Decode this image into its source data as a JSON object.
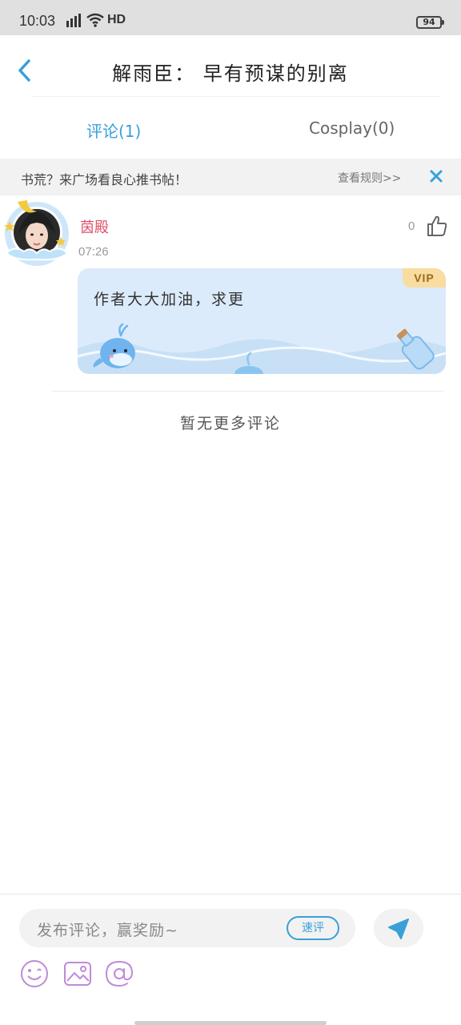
{
  "status_bar": {
    "time": "10:03",
    "network": "4G",
    "hd": "HD",
    "battery": "94"
  },
  "header": {
    "title": "解雨臣： 早有预谋的别离",
    "back_icon": "chevron-left-icon"
  },
  "tabs": [
    {
      "label": "评论(1)",
      "active": true
    },
    {
      "label": "Cosplay(0)",
      "active": false
    }
  ],
  "notice": {
    "text": "书荒？来广场看良心推书帖！",
    "rules_link": "查看规则>>",
    "close_icon": "close-icon"
  },
  "comment": {
    "username": "茵殿",
    "time": "07:26",
    "like_count": "0",
    "text": "作者大大加油，求更",
    "badge": "VIP"
  },
  "footer_note": "暂无更多评论",
  "composer": {
    "placeholder": "发布评论，赢奖励~",
    "quick_label": "速评",
    "tools": [
      "emoji-icon",
      "image-icon",
      "mention-icon"
    ]
  },
  "colors": {
    "accent": "#39a0d8",
    "username": "#e0506a",
    "bubble": "#dcebfb",
    "vip": "#f8dca0"
  }
}
